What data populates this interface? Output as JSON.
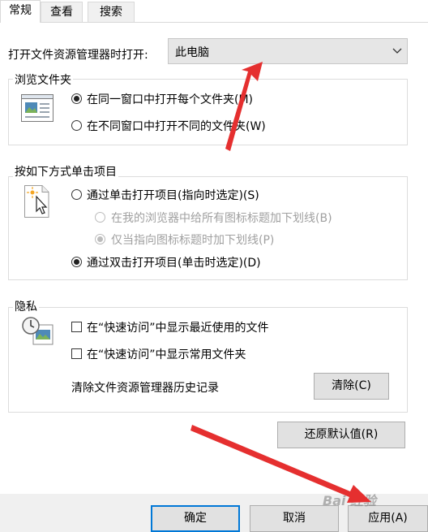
{
  "tabs": [
    {
      "label": "常规"
    },
    {
      "label": "查看"
    },
    {
      "label": "搜索"
    }
  ],
  "open_explorer": {
    "label": "打开文件资源管理器时打开:",
    "value": "此电脑"
  },
  "browse_folders": {
    "title": "浏览文件夹",
    "options": [
      {
        "label": "在同一窗口中打开每个文件夹(M)",
        "selected": true
      },
      {
        "label": "在不同窗口中打开不同的文件夹(W)",
        "selected": false
      }
    ]
  },
  "click_items": {
    "title": "按如下方式单击项目",
    "single": {
      "label": "通过单击打开项目(指向时选定)(S)",
      "selected": false
    },
    "sub_options": [
      {
        "label": "在我的浏览器中给所有图标标题加下划线(B)",
        "selected": false
      },
      {
        "label": "仅当指向图标标题时加下划线(P)",
        "selected": true
      }
    ],
    "double": {
      "label": "通过双击打开项目(单击时选定)(D)",
      "selected": true
    }
  },
  "privacy": {
    "title": "隐私",
    "show_recent": "在“快速访问”中显示最近使用的文件",
    "show_frequent": "在“快速访问”中显示常用文件夹",
    "clear_label": "清除文件资源管理器历史记录",
    "clear_button": "清除(C)"
  },
  "restore_button": "还原默认值(R)",
  "footer": {
    "ok": "确定",
    "cancel": "取消",
    "apply": "应用(A)"
  },
  "watermark": "Bai 经验"
}
